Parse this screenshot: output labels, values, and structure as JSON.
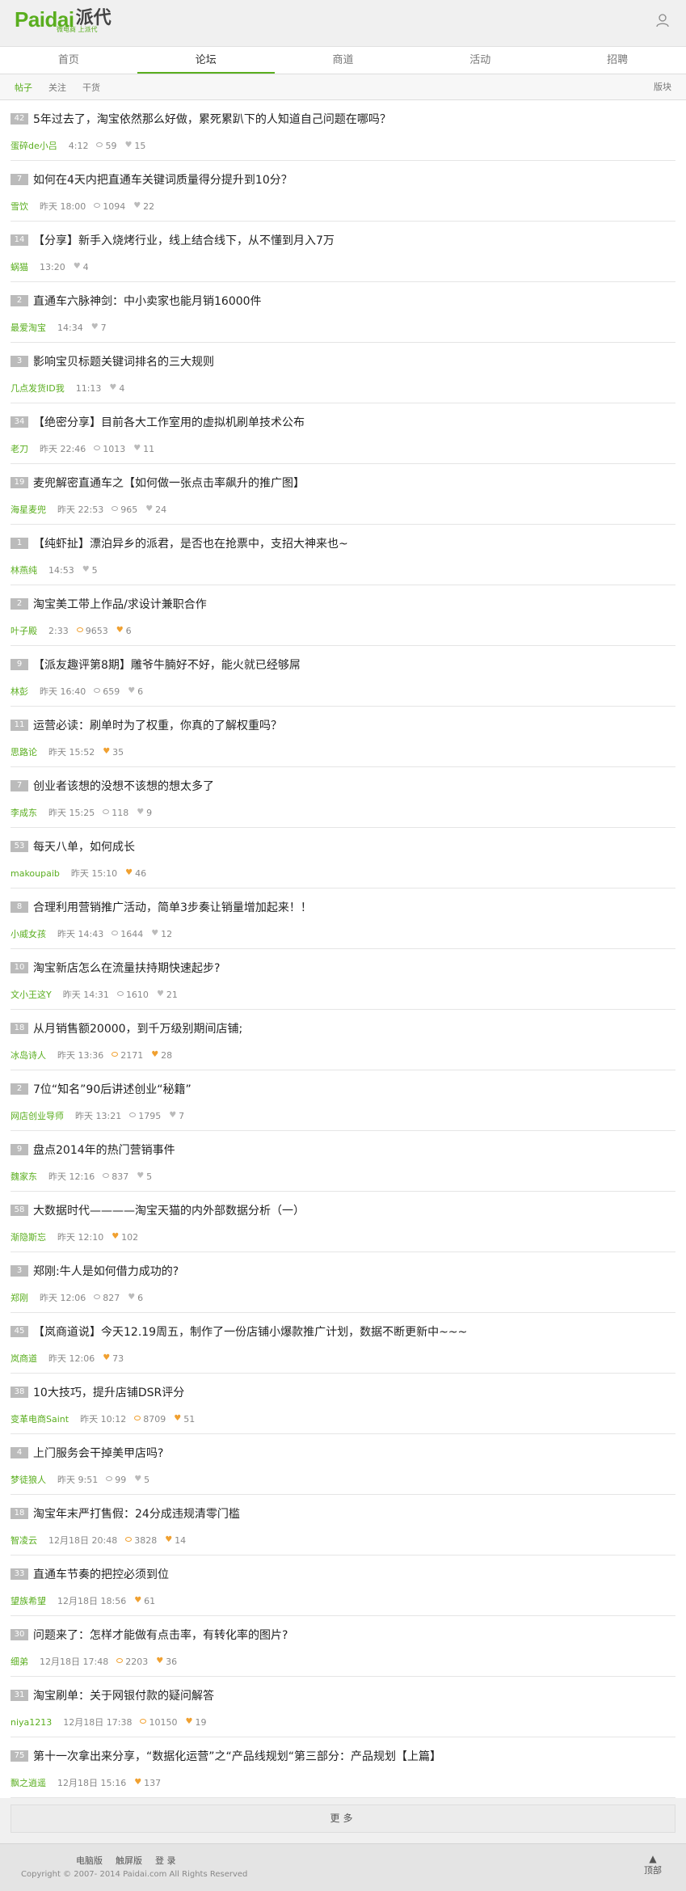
{
  "header": {
    "logo_en": "Paidai",
    "logo_cn": "派代",
    "logo_sub": "微电商 上派代",
    "user_icon": "user-icon"
  },
  "nav": [
    {
      "label": "首页",
      "active": false
    },
    {
      "label": "论坛",
      "active": true
    },
    {
      "label": "商道",
      "active": false
    },
    {
      "label": "活动",
      "active": false
    },
    {
      "label": "招聘",
      "active": false
    }
  ],
  "subnav": {
    "items": [
      {
        "label": "帖子",
        "active": true
      },
      {
        "label": "关注",
        "active": false
      },
      {
        "label": "干货",
        "active": false
      }
    ],
    "right": "版块"
  },
  "posts": [
    {
      "badge": "42",
      "title": "5年过去了，淘宝依然那么好做，累死累趴下的人知道自己问题在哪吗？",
      "author": "蛋碎de小吕",
      "time": "4:12",
      "views": "59",
      "likes": "15",
      "hot": false
    },
    {
      "badge": "7",
      "title": "如何在4天内把直通车关键词质量得分提升到10分？",
      "author": "雪饮",
      "time": "昨天 18:00",
      "views": "1094",
      "likes": "22",
      "hot": false
    },
    {
      "badge": "14",
      "title": "【分享】新手入烧烤行业，线上结合线下，从不懂到月入7万",
      "author": "蜗猫",
      "time": "13:20",
      "views": "",
      "likes": "4",
      "hot": false
    },
    {
      "badge": "2",
      "title": "直通车六脉神剑：中小卖家也能月销16000件",
      "author": "最爱淘宝",
      "time": "14:34",
      "views": "",
      "likes": "7",
      "hot": false
    },
    {
      "badge": "3",
      "title": "影响宝贝标题关键词排名的三大规则",
      "author": "几点发货ID我",
      "time": "11:13",
      "views": "",
      "likes": "4",
      "hot": false
    },
    {
      "badge": "34",
      "title": "【绝密分享】目前各大工作室用的虚拟机刷单技术公布",
      "author": "老刀",
      "time": "昨天 22:46",
      "views": "1013",
      "likes": "11",
      "hot": false
    },
    {
      "badge": "19",
      "title": "麦兜解密直通车之【如何做一张点击率飙升的推广图】",
      "author": "海星麦兜",
      "time": "昨天 22:53",
      "views": "965",
      "likes": "24",
      "hot": false
    },
    {
      "badge": "1",
      "title": "【纯虾扯】漂泊异乡的派君，是否也在抢票中，支招大神来也~",
      "author": "林燕纯",
      "time": "14:53",
      "views": "",
      "likes": "5",
      "hot": false
    },
    {
      "badge": "2",
      "title": "淘宝美工带上作品/求设计兼职合作",
      "author": "叶子殿",
      "time": "2:33",
      "views": "9653",
      "likes": "6",
      "hot": true
    },
    {
      "badge": "9",
      "title": "【派友趣评第8期】雕爷牛腩好不好，能火就已经够屌",
      "author": "林彭",
      "time": "昨天 16:40",
      "views": "659",
      "likes": "6",
      "hot": false
    },
    {
      "badge": "11",
      "title": "运营必读：刷单时为了权重，你真的了解权重吗？",
      "author": "思路论",
      "time": "昨天 15:52",
      "views": "",
      "likes": "35",
      "hot": true
    },
    {
      "badge": "7",
      "title": "创业者该想的没想不该想的想太多了",
      "author": "李成东",
      "time": "昨天 15:25",
      "views": "118",
      "likes": "9",
      "hot": false
    },
    {
      "badge": "53",
      "title": "每天八单，如何成长",
      "author": "makoupaib",
      "time": "昨天 15:10",
      "views": "",
      "likes": "46",
      "hot": true
    },
    {
      "badge": "8",
      "title": "合理利用营销推广活动，简单3步奏让销量增加起来！！",
      "author": "小威女孩",
      "time": "昨天 14:43",
      "views": "1644",
      "likes": "12",
      "hot": false
    },
    {
      "badge": "10",
      "title": "淘宝新店怎么在流量扶持期快速起步?",
      "author": "文小王这Y",
      "time": "昨天 14:31",
      "views": "1610",
      "likes": "21",
      "hot": false
    },
    {
      "badge": "18",
      "title": "从月销售额20000，到千万级别期间店铺;",
      "author": "冰岛诗人",
      "time": "昨天 13:36",
      "views": "2171",
      "likes": "28",
      "hot": true
    },
    {
      "badge": "2",
      "title": "7位“知名”90后讲述创业“秘籍”",
      "author": "网店创业导师",
      "time": "昨天 13:21",
      "views": "1795",
      "likes": "7",
      "hot": false
    },
    {
      "badge": "9",
      "title": "盘点2014年的热门营销事件",
      "author": "魏家东",
      "time": "昨天 12:16",
      "views": "837",
      "likes": "5",
      "hot": false
    },
    {
      "badge": "58",
      "title": "大数据时代————淘宝天猫的内外部数据分析（一）",
      "author": "渐隐斯忘",
      "time": "昨天 12:10",
      "views": "",
      "likes": "102",
      "hot": true
    },
    {
      "badge": "3",
      "title": "郑刚:牛人是如何借力成功的?",
      "author": "郑刚",
      "time": "昨天 12:06",
      "views": "827",
      "likes": "6",
      "hot": false
    },
    {
      "badge": "45",
      "title": "【岚商道说】今天12.19周五，制作了一份店铺小爆款推广计划，数据不断更新中~~~",
      "author": "岚商道",
      "time": "昨天 12:06",
      "views": "",
      "likes": "73",
      "hot": true
    },
    {
      "badge": "38",
      "title": "10大技巧，提升店铺DSR评分",
      "author": "变革电商Saint",
      "time": "昨天 10:12",
      "views": "8709",
      "likes": "51",
      "hot": true
    },
    {
      "badge": "4",
      "title": "上门服务会干掉美甲店吗?",
      "author": "梦徒狼人",
      "time": "昨天 9:51",
      "views": "99",
      "likes": "5",
      "hot": false
    },
    {
      "badge": "18",
      "title": "淘宝年末严打售假：24分成违规清零门槛",
      "author": "智凌云",
      "time": "12月18日 20:48",
      "views": "3828",
      "likes": "14",
      "hot": true
    },
    {
      "badge": "33",
      "title": "直通车节奏的把控必须到位",
      "author": "望族希望",
      "time": "12月18日 18:56",
      "views": "",
      "likes": "61",
      "hot": true
    },
    {
      "badge": "30",
      "title": "问题来了：怎样才能做有点击率，有转化率的图片?",
      "author": "细弟",
      "time": "12月18日 17:48",
      "views": "2203",
      "likes": "36",
      "hot": true
    },
    {
      "badge": "31",
      "title": "淘宝刷单：关于网银付款的疑问解答",
      "author": "niya1213",
      "time": "12月18日 17:38",
      "views": "10150",
      "likes": "19",
      "hot": true
    },
    {
      "badge": "75",
      "title": "第十一次拿出来分享，“数据化运营”之“产品线规划“第三部分：产品规划【上篇】",
      "author": "飘之逍遥",
      "time": "12月18日 15:16",
      "views": "",
      "likes": "137",
      "hot": true
    }
  ],
  "more_label": "更多",
  "footer": {
    "links": [
      "电脑版",
      "触屏版",
      "登 录"
    ],
    "copyright": "Copyright © 2007- 2014 Paidai.com All Rights Reserved",
    "top_label": "顶部"
  },
  "colors": {
    "accent": "#5aae1f",
    "hot": "#f0a030"
  }
}
